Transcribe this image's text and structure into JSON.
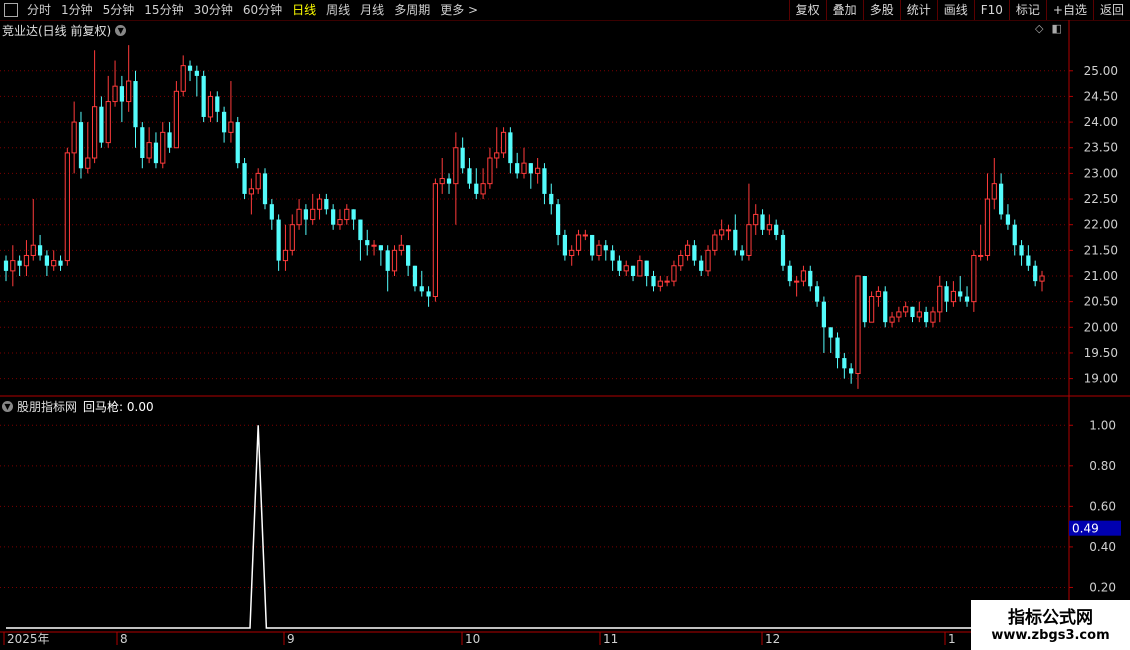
{
  "toolbar": {
    "periods": [
      "分时",
      "1分钟",
      "5分钟",
      "15分钟",
      "30分钟",
      "60分钟",
      "日线",
      "周线",
      "月线",
      "多周期",
      "更多 >"
    ],
    "active_index": 6,
    "right": [
      "复权",
      "叠加",
      "多股",
      "统计",
      "画线",
      "F10",
      "标记",
      "+自选",
      "返回"
    ]
  },
  "main": {
    "title": "竞业达(日线 前复权)",
    "y_ticks": [
      "25.00",
      "24.50",
      "24.00",
      "23.50",
      "23.00",
      "22.50",
      "22.00",
      "21.50",
      "21.00",
      "20.50",
      "20.00",
      "19.50",
      "19.00"
    ]
  },
  "indicator": {
    "name": "股朋指标网",
    "signal_label": "回马枪: 0.00",
    "y_ticks": [
      "1.00",
      "0.80",
      "0.60",
      "0.40",
      "0.20"
    ],
    "cursor_value": "0.49"
  },
  "x_axis": {
    "labels": [
      "2025年",
      "8",
      "9",
      "10",
      "11",
      "12",
      "1"
    ]
  },
  "watermark": {
    "line1": "指标公式网",
    "line2": "www.zbgs3.com"
  },
  "colors": {
    "up": "#ff3b3b",
    "down": "#54fcfc",
    "grid": "#7a0000",
    "signal": "#ffffff"
  },
  "chart_data": [
    {
      "type": "candlestick",
      "title": "竞业达(日线 前复权)",
      "ylim": [
        18.7,
        25.6
      ],
      "columns": [
        "open",
        "close",
        "high",
        "low"
      ],
      "candles": [
        [
          21.3,
          21.1,
          21.4,
          20.9
        ],
        [
          21.1,
          21.3,
          21.6,
          20.8
        ],
        [
          21.3,
          21.2,
          21.4,
          21.0
        ],
        [
          21.2,
          21.4,
          21.7,
          21.0
        ],
        [
          21.4,
          21.6,
          22.5,
          21.3
        ],
        [
          21.6,
          21.4,
          21.8,
          21.3
        ],
        [
          21.4,
          21.2,
          21.5,
          21.0
        ],
        [
          21.2,
          21.3,
          21.5,
          21.1
        ],
        [
          21.3,
          21.2,
          21.4,
          21.1
        ],
        [
          21.3,
          23.4,
          23.5,
          21.2
        ],
        [
          23.4,
          24.0,
          24.4,
          23.0
        ],
        [
          24.0,
          23.1,
          24.2,
          22.9
        ],
        [
          23.1,
          23.3,
          24.0,
          23.0
        ],
        [
          23.3,
          24.3,
          25.4,
          23.2
        ],
        [
          24.3,
          23.6,
          24.5,
          23.5
        ],
        [
          23.6,
          24.4,
          24.9,
          23.5
        ],
        [
          24.4,
          24.7,
          25.2,
          24.3
        ],
        [
          24.7,
          24.4,
          24.9,
          24.0
        ],
        [
          24.4,
          24.8,
          25.5,
          24.2
        ],
        [
          24.8,
          23.9,
          25.0,
          23.5
        ],
        [
          23.9,
          23.3,
          24.0,
          23.1
        ],
        [
          23.3,
          23.6,
          23.9,
          23.2
        ],
        [
          23.6,
          23.2,
          23.8,
          23.1
        ],
        [
          23.2,
          23.8,
          24.0,
          23.1
        ],
        [
          23.8,
          23.5,
          24.0,
          23.4
        ],
        [
          23.5,
          24.6,
          24.8,
          23.5
        ],
        [
          24.6,
          25.1,
          25.3,
          24.5
        ],
        [
          25.1,
          25.0,
          25.2,
          24.8
        ],
        [
          25.0,
          24.9,
          25.1,
          24.5
        ],
        [
          24.9,
          24.1,
          25.0,
          24.0
        ],
        [
          24.1,
          24.5,
          24.6,
          24.0
        ],
        [
          24.5,
          24.2,
          24.6,
          24.0
        ],
        [
          24.2,
          23.8,
          24.3,
          23.6
        ],
        [
          23.8,
          24.0,
          24.8,
          23.6
        ],
        [
          24.0,
          23.2,
          24.1,
          23.1
        ],
        [
          23.2,
          22.6,
          23.3,
          22.5
        ],
        [
          22.6,
          22.7,
          22.9,
          22.2
        ],
        [
          22.7,
          23.0,
          23.1,
          22.6
        ],
        [
          23.0,
          22.4,
          23.1,
          22.3
        ],
        [
          22.4,
          22.1,
          22.5,
          21.9
        ],
        [
          22.1,
          21.3,
          22.2,
          21.1
        ],
        [
          21.3,
          21.5,
          22.0,
          21.1
        ],
        [
          21.5,
          22.0,
          22.2,
          21.4
        ],
        [
          22.0,
          22.3,
          22.5,
          21.9
        ],
        [
          22.3,
          22.1,
          22.4,
          21.8
        ],
        [
          22.1,
          22.3,
          22.6,
          22.0
        ],
        [
          22.3,
          22.5,
          22.6,
          22.1
        ],
        [
          22.5,
          22.3,
          22.6,
          22.2
        ],
        [
          22.3,
          22.0,
          22.4,
          21.9
        ],
        [
          22.0,
          22.1,
          22.3,
          21.9
        ],
        [
          22.1,
          22.3,
          22.4,
          22.0
        ],
        [
          22.3,
          22.1,
          22.3,
          21.9
        ],
        [
          22.1,
          21.7,
          22.1,
          21.3
        ],
        [
          21.7,
          21.6,
          21.9,
          21.4
        ],
        [
          21.6,
          21.6,
          21.7,
          21.4
        ],
        [
          21.6,
          21.5,
          21.6,
          21.2
        ],
        [
          21.5,
          21.1,
          21.6,
          20.7
        ],
        [
          21.1,
          21.5,
          21.6,
          21.0
        ],
        [
          21.5,
          21.6,
          21.8,
          21.4
        ],
        [
          21.6,
          21.2,
          21.6,
          21.0
        ],
        [
          21.2,
          20.8,
          21.2,
          20.7
        ],
        [
          20.8,
          20.7,
          21.1,
          20.6
        ],
        [
          20.7,
          20.6,
          20.8,
          20.4
        ],
        [
          20.6,
          22.8,
          22.9,
          20.5
        ],
        [
          22.8,
          22.9,
          23.3,
          22.6
        ],
        [
          22.9,
          22.8,
          23.0,
          22.6
        ],
        [
          22.8,
          23.5,
          23.8,
          22.0
        ],
        [
          23.5,
          23.1,
          23.7,
          23.0
        ],
        [
          23.1,
          22.8,
          23.3,
          22.7
        ],
        [
          22.8,
          22.6,
          23.1,
          22.5
        ],
        [
          22.6,
          22.8,
          23.1,
          22.5
        ],
        [
          22.8,
          23.3,
          23.5,
          22.7
        ],
        [
          23.3,
          23.4,
          23.9,
          23.1
        ],
        [
          23.4,
          23.8,
          23.9,
          23.3
        ],
        [
          23.8,
          23.2,
          23.9,
          23.0
        ],
        [
          23.2,
          23.0,
          23.4,
          22.9
        ],
        [
          23.0,
          23.2,
          23.5,
          22.9
        ],
        [
          23.2,
          23.0,
          23.2,
          22.7
        ],
        [
          23.0,
          23.1,
          23.3,
          22.8
        ],
        [
          23.1,
          22.6,
          23.2,
          22.4
        ],
        [
          22.6,
          22.4,
          22.8,
          22.2
        ],
        [
          22.4,
          21.8,
          22.5,
          21.6
        ],
        [
          21.8,
          21.4,
          21.9,
          21.3
        ],
        [
          21.4,
          21.5,
          21.6,
          21.2
        ],
        [
          21.5,
          21.8,
          21.9,
          21.4
        ],
        [
          21.8,
          21.8,
          21.9,
          21.7
        ],
        [
          21.8,
          21.4,
          21.8,
          21.3
        ],
        [
          21.4,
          21.6,
          21.7,
          21.3
        ],
        [
          21.6,
          21.5,
          21.7,
          21.3
        ],
        [
          21.5,
          21.3,
          21.6,
          21.1
        ],
        [
          21.3,
          21.1,
          21.4,
          21.0
        ],
        [
          21.1,
          21.2,
          21.3,
          21.0
        ],
        [
          21.2,
          21.0,
          21.2,
          20.9
        ],
        [
          21.0,
          21.3,
          21.4,
          21.0
        ],
        [
          21.3,
          21.0,
          21.3,
          20.8
        ],
        [
          21.0,
          20.8,
          21.1,
          20.7
        ],
        [
          20.8,
          20.9,
          21.0,
          20.7
        ],
        [
          20.9,
          20.9,
          21.0,
          20.8
        ],
        [
          20.9,
          21.2,
          21.3,
          20.8
        ],
        [
          21.2,
          21.4,
          21.5,
          21.1
        ],
        [
          21.4,
          21.6,
          21.7,
          21.3
        ],
        [
          21.6,
          21.3,
          21.7,
          21.2
        ],
        [
          21.3,
          21.1,
          21.4,
          21.0
        ],
        [
          21.1,
          21.5,
          21.6,
          21.0
        ],
        [
          21.5,
          21.8,
          21.9,
          21.4
        ],
        [
          21.8,
          21.9,
          22.1,
          21.7
        ],
        [
          21.9,
          21.9,
          22.0,
          21.7
        ],
        [
          21.9,
          21.5,
          22.2,
          21.4
        ],
        [
          21.5,
          21.4,
          21.6,
          21.3
        ],
        [
          21.4,
          22.0,
          22.8,
          21.3
        ],
        [
          22.0,
          22.2,
          22.4,
          21.8
        ],
        [
          22.2,
          21.9,
          22.3,
          21.8
        ],
        [
          21.9,
          22.0,
          22.2,
          21.8
        ],
        [
          22.0,
          21.8,
          22.1,
          21.7
        ],
        [
          21.8,
          21.2,
          21.9,
          21.1
        ],
        [
          21.2,
          20.9,
          21.3,
          20.8
        ],
        [
          20.9,
          20.9,
          21.0,
          20.6
        ],
        [
          20.9,
          21.1,
          21.2,
          20.8
        ],
        [
          21.1,
          20.8,
          21.2,
          20.7
        ],
        [
          20.8,
          20.5,
          20.9,
          20.4
        ],
        [
          20.5,
          20.0,
          20.6,
          19.5
        ],
        [
          20.0,
          19.8,
          20.0,
          19.5
        ],
        [
          19.8,
          19.4,
          19.9,
          19.2
        ],
        [
          19.4,
          19.2,
          19.5,
          19.0
        ],
        [
          19.2,
          19.1,
          19.3,
          18.9
        ],
        [
          19.1,
          21.0,
          21.0,
          18.8
        ],
        [
          21.0,
          20.1,
          21.0,
          20.0
        ],
        [
          20.1,
          20.6,
          20.7,
          20.1
        ],
        [
          20.6,
          20.7,
          20.8,
          20.4
        ],
        [
          20.7,
          20.1,
          20.8,
          20.0
        ],
        [
          20.1,
          20.2,
          20.3,
          20.0
        ],
        [
          20.2,
          20.3,
          20.4,
          20.1
        ],
        [
          20.3,
          20.4,
          20.5,
          20.2
        ],
        [
          20.4,
          20.2,
          20.4,
          20.1
        ],
        [
          20.2,
          20.3,
          20.5,
          20.1
        ],
        [
          20.3,
          20.1,
          20.4,
          20.0
        ],
        [
          20.1,
          20.3,
          20.4,
          20.0
        ],
        [
          20.3,
          20.8,
          21.0,
          20.1
        ],
        [
          20.8,
          20.5,
          20.9,
          20.3
        ],
        [
          20.5,
          20.7,
          20.9,
          20.4
        ],
        [
          20.7,
          20.6,
          21.0,
          20.5
        ],
        [
          20.6,
          20.5,
          20.8,
          20.4
        ],
        [
          20.5,
          21.4,
          21.5,
          20.3
        ],
        [
          21.4,
          21.4,
          22.0,
          21.3
        ],
        [
          21.4,
          22.5,
          23.0,
          21.3
        ],
        [
          22.5,
          22.8,
          23.3,
          22.3
        ],
        [
          22.8,
          22.2,
          23.0,
          22.1
        ],
        [
          22.2,
          22.0,
          22.4,
          21.9
        ],
        [
          22.0,
          21.6,
          22.1,
          21.4
        ],
        [
          21.6,
          21.4,
          21.7,
          21.2
        ],
        [
          21.4,
          21.2,
          21.6,
          21.1
        ],
        [
          21.2,
          20.9,
          21.3,
          20.8
        ],
        [
          20.9,
          21.0,
          21.1,
          20.7
        ]
      ]
    },
    {
      "type": "line",
      "series": [
        {
          "name": "回马枪",
          "spike_index": 37,
          "spike_value": 1.0
        }
      ],
      "ylim": [
        0,
        1.1
      ]
    }
  ]
}
